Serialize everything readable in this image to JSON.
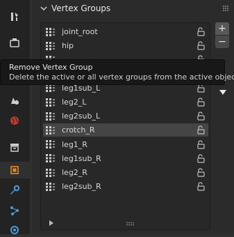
{
  "panel": {
    "title": "Vertex Groups",
    "add_icon": "+",
    "remove_icon": "−"
  },
  "vertex_groups": [
    {
      "name": "joint_root",
      "selected": false
    },
    {
      "name": "hip",
      "selected": false
    },
    {
      "name": "",
      "selected": false
    },
    {
      "name": "",
      "selected": false
    },
    {
      "name": "leg1sub_L",
      "selected": false
    },
    {
      "name": "leg2_L",
      "selected": false
    },
    {
      "name": "leg2sub_L",
      "selected": false
    },
    {
      "name": "crotch_R",
      "selected": true
    },
    {
      "name": "leg1_R",
      "selected": false
    },
    {
      "name": "leg1sub_R",
      "selected": false
    },
    {
      "name": "leg2_R",
      "selected": false
    },
    {
      "name": "leg2sub_R",
      "selected": false
    }
  ],
  "tooltip": {
    "title": "Remove Vertex Group",
    "description": "Delete the active or all vertex groups from the active object."
  },
  "sidebar_icons": [
    "tool-icon",
    "render-icon",
    "output-icon",
    "view-layer-icon",
    "scene-icon",
    "world-icon",
    "collection-icon",
    "object-icon",
    "modifier-icon",
    "particles-icon",
    "physics-icon"
  ],
  "colors": {
    "accent": "#e28a2e",
    "selected_row": "#454545"
  }
}
